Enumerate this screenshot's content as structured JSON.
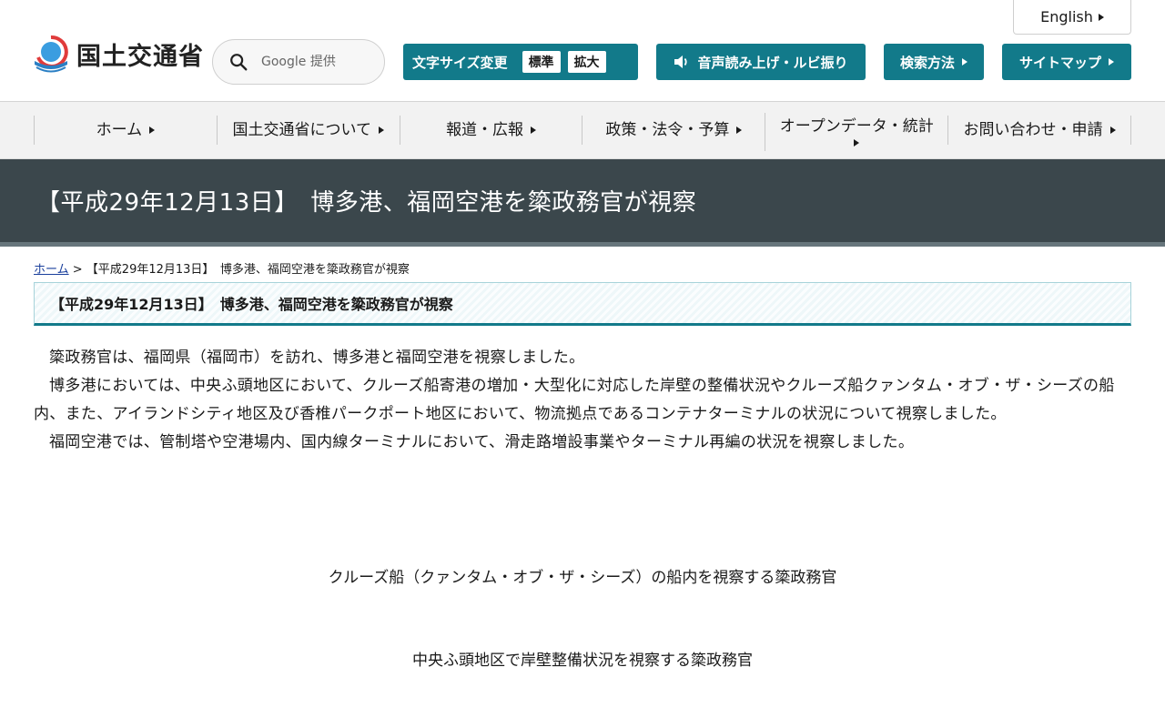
{
  "header": {
    "lang_label": "English",
    "logo_text": "国土交通省",
    "search_placeholder": "Google 提供",
    "font_size_label": "文字サイズ変更",
    "font_size_options": [
      "標準",
      "拡大"
    ],
    "voice_label": "音声読み上げ・ルビ振り",
    "search_method_label": "検索方法",
    "sitemap_label": "サイトマップ"
  },
  "nav": {
    "items": [
      "ホーム",
      "国土交通省について",
      "報道・広報",
      "政策・法令・予算",
      "オープンデータ・統計",
      "お問い合わせ・申請"
    ]
  },
  "page": {
    "title": "【平成29年12月13日】　博多港、福岡空港を簗政務官が視察"
  },
  "breadcrumb": {
    "home": "ホーム",
    "separator": " > ",
    "current": "【平成29年12月13日】　博多港、福岡空港を簗政務官が視察"
  },
  "article": {
    "heading": "【平成29年12月13日】　博多港、福岡空港を簗政務官が視察",
    "paragraphs": [
      "簗政務官は、福岡県（福岡市）を訪れ、博多港と福岡空港を視察しました。",
      "博多港においては、中央ふ頭地区において、クルーズ船寄港の増加・大型化に対応した岸壁の整備状況やクルーズ船クァンタム・オブ・ザ・シーズの船内、また、アイランドシティ地区及び香椎パークポート地区において、物流拠点であるコンテナターミナルの状況について視察しました。",
      "福岡空港では、管制塔や空港場内、国内線ターミナルにおいて、滑走路増設事業やターミナル再編の状況を視察しました。"
    ],
    "captions": [
      "クルーズ船（クァンタム・オブ・ザ・シーズ）の船内を視察する簗政務官",
      "中央ふ頭地区で岸壁整備状況を視察する簗政務官"
    ]
  },
  "colors": {
    "accent": "#127a8a",
    "title_band": "#3b474c",
    "link": "#1a3f9c"
  }
}
